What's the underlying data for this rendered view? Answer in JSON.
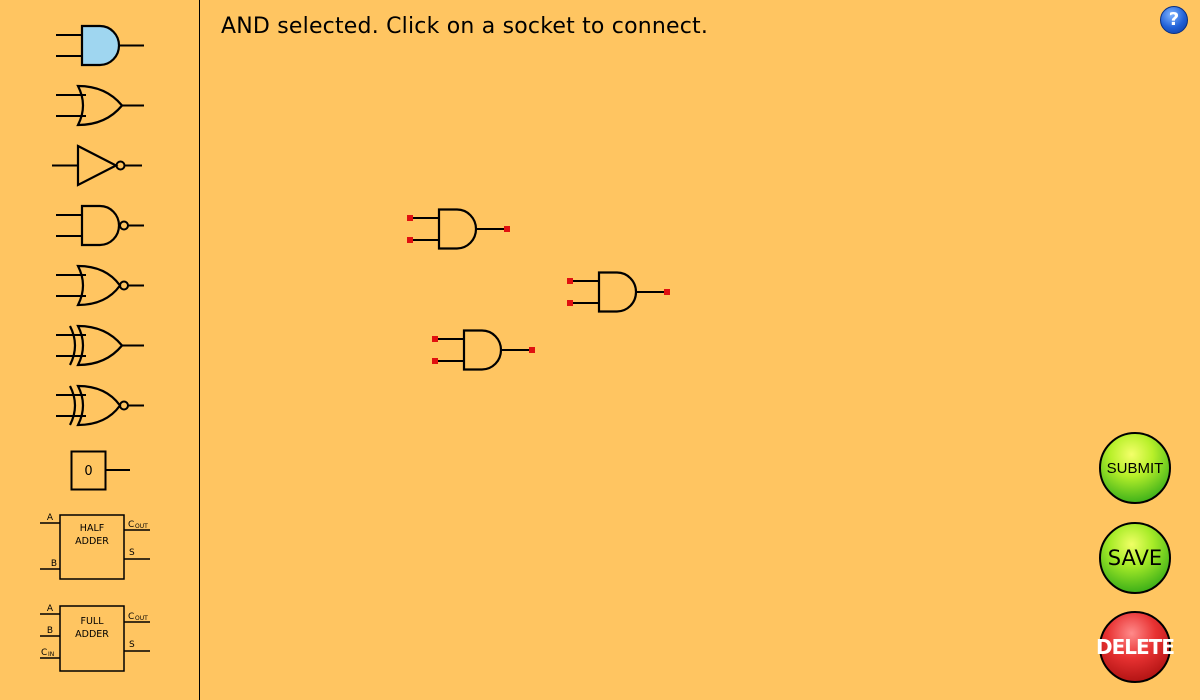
{
  "status": {
    "message": "AND selected. Click on a socket to connect."
  },
  "help": {
    "label": "?"
  },
  "palette": {
    "items": [
      {
        "name": "AND",
        "selected": true
      },
      {
        "name": "OR"
      },
      {
        "name": "NOT"
      },
      {
        "name": "NAND"
      },
      {
        "name": "NOR"
      },
      {
        "name": "XOR"
      },
      {
        "name": "XNOR"
      },
      {
        "name": "INPUT"
      },
      {
        "name": "HALF ADDER"
      },
      {
        "name": "FULL ADDER"
      }
    ],
    "input_value": "0",
    "half_adder": {
      "title_line1": "HALF",
      "title_line2": "ADDER",
      "in_a": "A",
      "in_b": "B",
      "out_c": "C",
      "out_c_sub": "OUT",
      "out_s": "S"
    },
    "full_adder": {
      "title_line1": "FULL",
      "title_line2": "ADDER",
      "in_a": "A",
      "in_b": "B",
      "in_c": "C",
      "in_c_sub": "IN",
      "out_c": "C",
      "out_c_sub": "OUT",
      "out_s": "S"
    }
  },
  "canvas": {
    "gates": [
      {
        "type": "AND"
      },
      {
        "type": "AND"
      },
      {
        "type": "AND"
      }
    ]
  },
  "buttons": {
    "submit": "SUBMIT",
    "save": "SAVE",
    "delete": "DELETE"
  },
  "colors": {
    "background": "#ffc561",
    "selected_gate_fill": "#9fd6f0",
    "socket": "#e01010"
  }
}
